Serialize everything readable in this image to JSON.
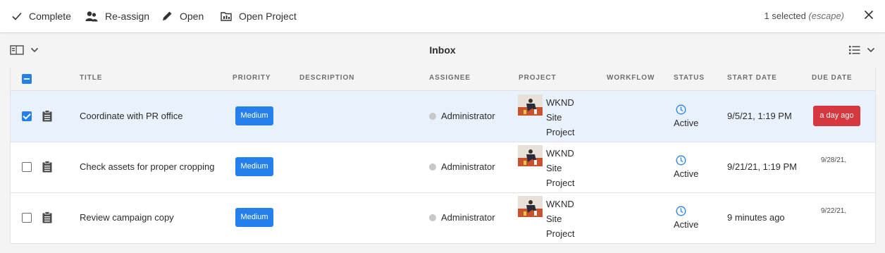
{
  "actionbar": {
    "actions": [
      {
        "label": "Complete",
        "icon": "checkmark-icon"
      },
      {
        "label": "Re-assign",
        "icon": "users-icon"
      },
      {
        "label": "Open",
        "icon": "pencil-icon"
      },
      {
        "label": "Open Project",
        "icon": "project-icon"
      }
    ],
    "selection_count": "1 selected",
    "selection_hint": "(escape)"
  },
  "titlebar": {
    "title": "Inbox"
  },
  "table": {
    "columns": [
      "TITLE",
      "PRIORITY",
      "DESCRIPTION",
      "ASSIGNEE",
      "PROJECT",
      "WORKFLOW",
      "STATUS",
      "START DATE",
      "DUE DATE"
    ],
    "rows": [
      {
        "selected": true,
        "title": "Coordinate with PR office",
        "priority": "Medium",
        "description": "",
        "assignee": "Administrator",
        "project_lines": [
          "WKND",
          "Site",
          "Project"
        ],
        "workflow": "",
        "status": "Active",
        "start_date": "9/5/21, 1:19 PM",
        "due_date": "a day ago",
        "due_overdue": true
      },
      {
        "selected": false,
        "title": "Check assets for proper cropping",
        "priority": "Medium",
        "description": "",
        "assignee": "Administrator",
        "project_lines": [
          "WKND",
          "Site",
          "Project"
        ],
        "workflow": "",
        "status": "Active",
        "start_date": "9/21/21, 1:19 PM",
        "due_date": "9/28/21,",
        "due_overdue": false
      },
      {
        "selected": false,
        "title": "Review campaign copy",
        "priority": "Medium",
        "description": "",
        "assignee": "Administrator",
        "project_lines": [
          "WKND",
          "Site",
          "Project"
        ],
        "workflow": "",
        "status": "Active",
        "start_date": "9 minutes ago",
        "due_date": "9/22/21,",
        "due_overdue": false
      }
    ]
  },
  "colors": {
    "accent": "#2680eb",
    "overdue": "#d7373f",
    "selected_row": "#e9f1fc",
    "status_icon": "#2680eb"
  }
}
